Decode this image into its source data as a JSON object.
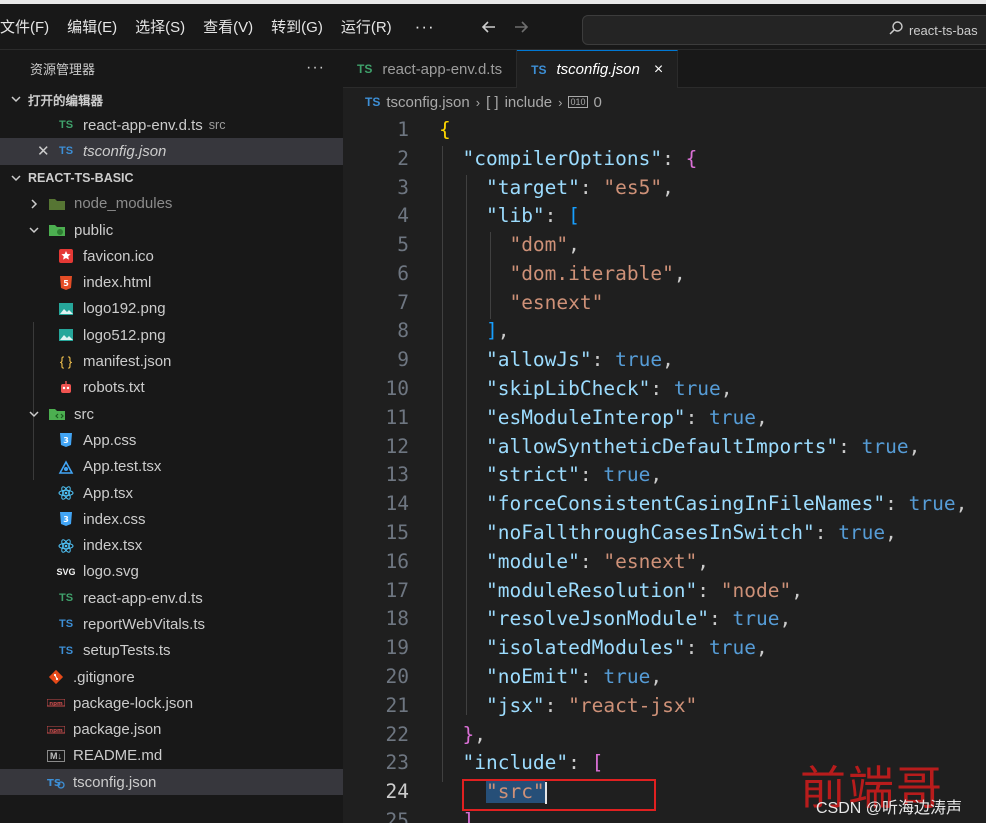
{
  "menu": {
    "items": [
      "文件(F)",
      "编辑(E)",
      "选择(S)",
      "查看(V)",
      "转到(G)",
      "运行(R)"
    ],
    "more": "···"
  },
  "search": {
    "text": "react-ts-bas"
  },
  "sidebar": {
    "title": "资源管理器",
    "more": "···",
    "open_editors_title": "打开的编辑器",
    "open_editors": [
      {
        "name": "react-app-env.d.ts",
        "desc": "src",
        "icon": "TS"
      },
      {
        "name": "tsconfig.json",
        "icon": "TS"
      }
    ],
    "project_title": "REACT-TS-BASIC",
    "tree": [
      {
        "name": "node_modules",
        "icon": "folder-node-icon"
      },
      {
        "name": "public",
        "icon": "folder-public-icon"
      },
      {
        "name": "favicon.ico",
        "icon": "favicon-icon"
      },
      {
        "name": "index.html",
        "icon": "html5-icon"
      },
      {
        "name": "logo192.png",
        "icon": "image-icon"
      },
      {
        "name": "logo512.png",
        "icon": "image-icon"
      },
      {
        "name": "manifest.json",
        "icon": "json-braces-icon",
        "glyph": "{ }"
      },
      {
        "name": "robots.txt",
        "icon": "robot-icon"
      },
      {
        "name": "src",
        "icon": "folder-src-icon"
      },
      {
        "name": "App.css",
        "icon": "css3-icon"
      },
      {
        "name": "App.test.tsx",
        "icon": "test-react-icon"
      },
      {
        "name": "App.tsx",
        "icon": "react-icon"
      },
      {
        "name": "index.css",
        "icon": "css3-icon"
      },
      {
        "name": "index.tsx",
        "icon": "react-icon"
      },
      {
        "name": "logo.svg",
        "icon": "svg-icon",
        "glyph": "SVG"
      },
      {
        "name": "react-app-env.d.ts",
        "icon": "ts-green-icon",
        "glyph": "TS"
      },
      {
        "name": "reportWebVitals.ts",
        "icon": "ts-blue-icon",
        "glyph": "TS"
      },
      {
        "name": "setupTests.ts",
        "icon": "ts-blue-icon",
        "glyph": "TS"
      },
      {
        "name": ".gitignore",
        "icon": "git-icon"
      },
      {
        "name": "package-lock.json",
        "icon": "npm-icon"
      },
      {
        "name": "package.json",
        "icon": "npm-icon"
      },
      {
        "name": "README.md",
        "icon": "markdown-icon",
        "glyph": "M↓"
      },
      {
        "name": "tsconfig.json",
        "icon": "tsconfig-icon"
      }
    ]
  },
  "tabs": [
    {
      "label": "react-app-env.d.ts",
      "icon": "TS"
    },
    {
      "label": "tsconfig.json",
      "icon": "TS",
      "close": "×"
    }
  ],
  "breadcrumb": {
    "file": "tsconfig.json",
    "sep": "›",
    "symbol": "include",
    "symbol_glyph": "[ ]",
    "index": "0"
  },
  "code": {
    "line_numbers": [
      "1",
      "2",
      "3",
      "4",
      "5",
      "6",
      "7",
      "8",
      "9",
      "10",
      "11",
      "12",
      "13",
      "14",
      "15",
      "16",
      "17",
      "18",
      "19",
      "20",
      "21",
      "22",
      "23",
      "24",
      "25"
    ],
    "current_line": "24"
  },
  "watermark": {
    "brand": "前端哥",
    "credit": "CSDN @听海边涛声"
  },
  "colors": {
    "key": "#9cdcfe",
    "string": "#ce9178",
    "boolean": "#569cd6",
    "bracket_gold": "#ffd700",
    "bracket_magenta": "#da70d6",
    "bracket_blue": "#179fff",
    "highlight_box": "#e02020"
  }
}
